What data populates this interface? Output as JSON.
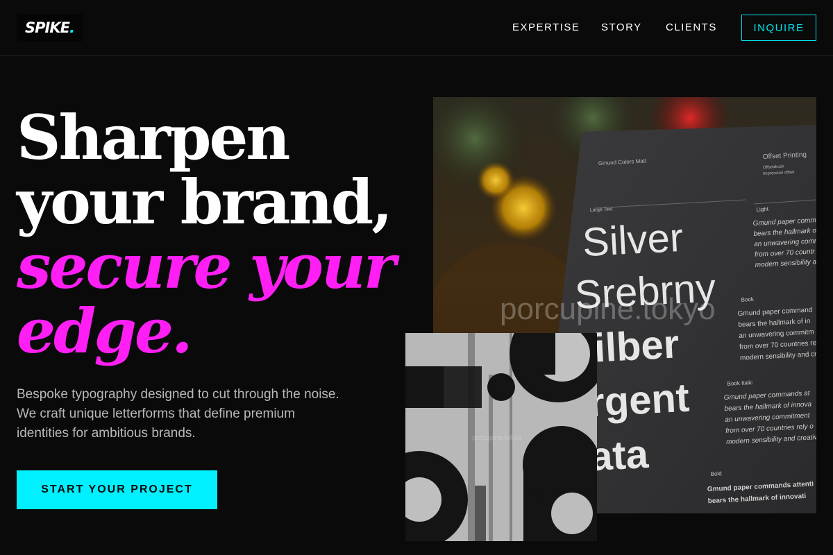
{
  "header": {
    "logo": {
      "text": "SPIKE",
      "dot": "."
    },
    "nav": [
      {
        "label": "EXPERTISE"
      },
      {
        "label": "STORY"
      },
      {
        "label": "CLIENTS"
      }
    ],
    "cta_label": "INQUIRE"
  },
  "hero": {
    "title_lines": [
      "Sharpen",
      "your brand,"
    ],
    "accent_lines": [
      "secure your",
      "edge."
    ],
    "subtitle": "Bespoke typography designed to cut through the noise. We craft unique letterforms that define premium identities for ambitious brands.",
    "button_label": "START YOUR PROJECT"
  },
  "photo_main": {
    "watermark": "porcupine.tokyo",
    "card_header_left": "Gmund Colors Matt",
    "card_header_right": "Offset Printing",
    "card_header_right_sub1": "Offsetdruck",
    "card_header_right_sub2": "Impression offset",
    "large_text_label": "Large Text",
    "words": [
      "Silver",
      "Srebrny",
      "Silber",
      "Argent",
      "Plata"
    ],
    "sections": [
      {
        "label": "Light",
        "lines": [
          "Gmund paper comm",
          "bears the hallmark o",
          "an unwavering comm",
          "from over 70 countr",
          "modern sensibility an"
        ]
      },
      {
        "label": "Book",
        "lines": [
          "Gmund paper command",
          "bears the hallmark of in",
          "an unwavering commitm",
          "from over 70 countries re",
          "modern sensibility and cr"
        ]
      },
      {
        "label": "Book Italic",
        "lines": [
          "Gmund paper commands at",
          "bears the hallmark of innova",
          "an unwavering commitment",
          "from over 70 countries rely o",
          "modern sensibility and creativ"
        ]
      },
      {
        "label": "Bold",
        "lines": [
          "Gmund paper commands attenti",
          "bears the hallmark of innovati"
        ]
      }
    ]
  },
  "photo_secondary": {
    "watermark": "porcupine.tokyo"
  },
  "colors": {
    "background": "#0a0a0a",
    "accent_magenta": "#ff1ff5",
    "accent_cyan": "#00f0ff"
  }
}
